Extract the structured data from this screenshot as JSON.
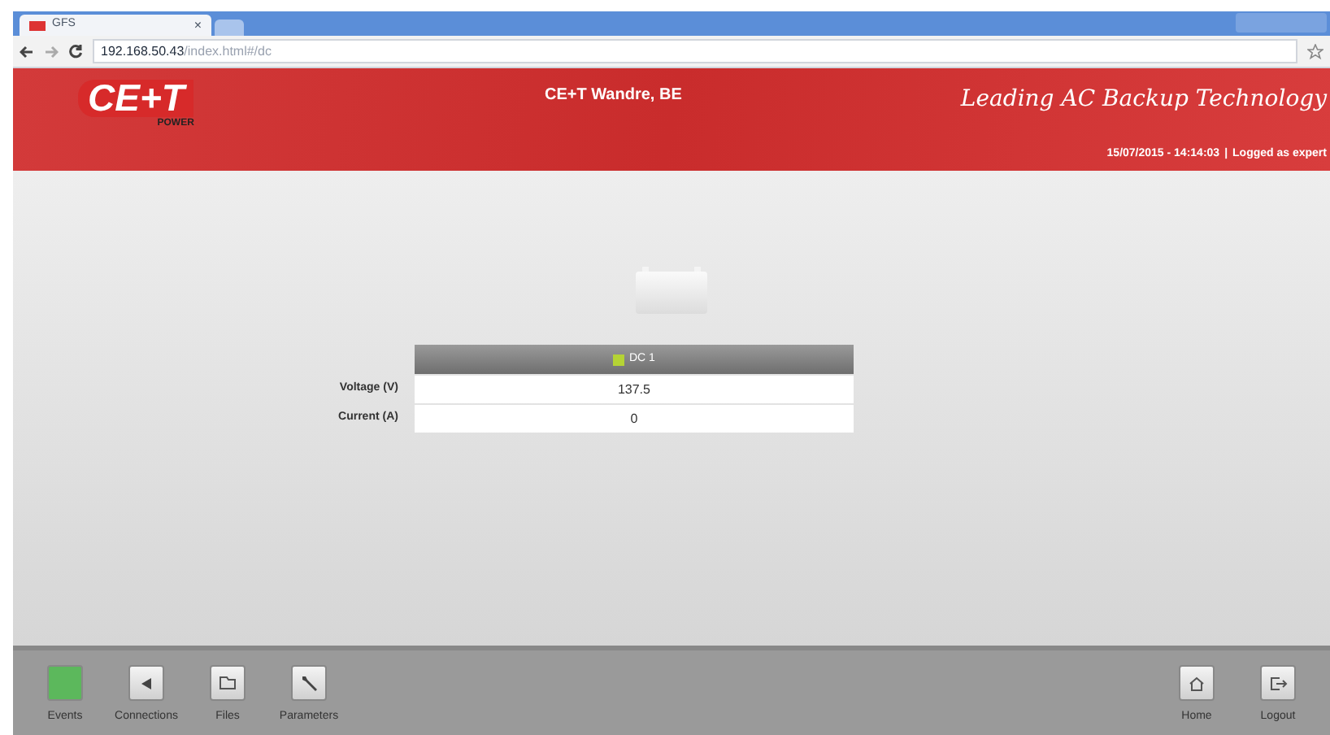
{
  "browser": {
    "tab_title": "GFS",
    "tab_close": "×",
    "url_host": "192.168.50.43",
    "url_path": "/index.html#/dc"
  },
  "header": {
    "logo": "CE+T",
    "logo_sub": "POWER",
    "site": "CE+T Wandre, BE",
    "tagline": "Leading AC Backup Technology",
    "datetime": "15/07/2015 - 14:14:03",
    "separator": "|",
    "login": "Logged as expert"
  },
  "table": {
    "column": {
      "label": "DC 1",
      "color": "#b5d334"
    },
    "rows": [
      {
        "label": "Voltage (V)",
        "value": "137.5"
      },
      {
        "label": "Current (A)",
        "value": "0"
      }
    ]
  },
  "footer": {
    "left": [
      {
        "kind": "status",
        "label": "Events",
        "color": "#5cb85c"
      },
      {
        "kind": "connections",
        "label": "Connections"
      },
      {
        "kind": "files",
        "label": "Files"
      },
      {
        "kind": "parameters",
        "label": "Parameters"
      }
    ],
    "right": [
      {
        "kind": "home",
        "label": "Home"
      },
      {
        "kind": "logout",
        "label": "Logout"
      }
    ]
  }
}
